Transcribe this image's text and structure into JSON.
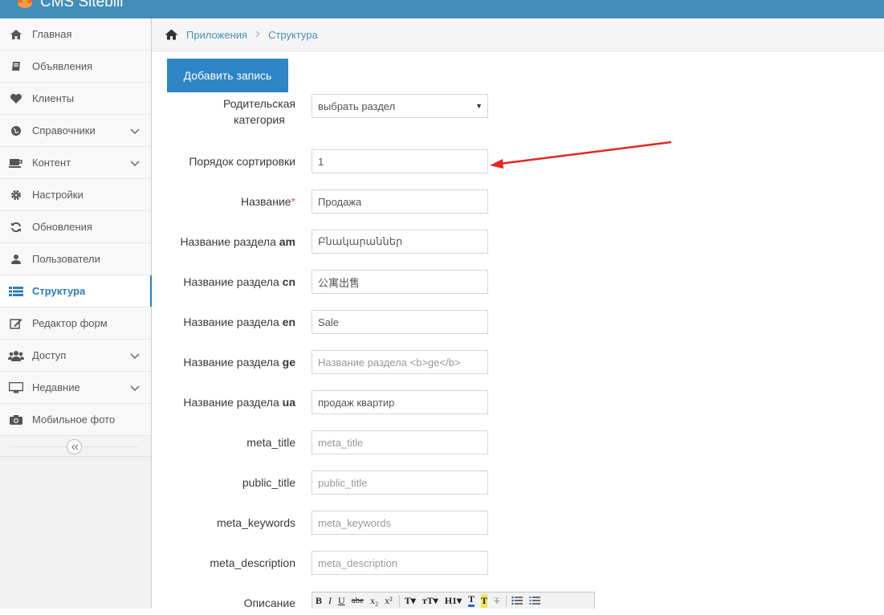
{
  "app": {
    "brand": "CMS Sitebill"
  },
  "sidebar": {
    "items": [
      {
        "label": "Главная",
        "icon": "home-icon",
        "has_submenu": false
      },
      {
        "label": "Объявления",
        "icon": "book-icon",
        "has_submenu": false
      },
      {
        "label": "Клиенты",
        "icon": "heart-icon",
        "has_submenu": false
      },
      {
        "label": "Справочники",
        "icon": "globe-icon",
        "has_submenu": true
      },
      {
        "label": "Контент",
        "icon": "coffee-icon",
        "has_submenu": true
      },
      {
        "label": "Настройки",
        "icon": "gear-icon",
        "has_submenu": false
      },
      {
        "label": "Обновления",
        "icon": "refresh-icon",
        "has_submenu": false
      },
      {
        "label": "Пользователи",
        "icon": "user-icon",
        "has_submenu": false
      },
      {
        "label": "Структура",
        "icon": "list-icon",
        "has_submenu": false,
        "active": true
      },
      {
        "label": "Редактор форм",
        "icon": "edit-icon",
        "has_submenu": false
      },
      {
        "label": "Доступ",
        "icon": "users-icon",
        "has_submenu": true
      },
      {
        "label": "Недавние",
        "icon": "desktop-icon",
        "has_submenu": true
      },
      {
        "label": "Мобильное фото",
        "icon": "camera-icon",
        "has_submenu": false
      }
    ]
  },
  "breadcrumbs": {
    "items": [
      "Приложения",
      "Структура"
    ]
  },
  "main": {
    "add_button": "Добавить запись",
    "form": {
      "parent_category": {
        "label_line1": "Родительская",
        "label_line2": "категория",
        "value": "выбрать раздел"
      },
      "sort_order": {
        "label": "Порядок сортировки",
        "value": "1"
      },
      "name": {
        "label": "Название",
        "required_mark": "*",
        "value": "Продажа"
      },
      "name_am": {
        "label": "Название раздела",
        "lang": "am",
        "value": "Բնակարաններ"
      },
      "name_cn": {
        "label": "Название раздела",
        "lang": "cn",
        "value": "公寓出售"
      },
      "name_en": {
        "label": "Название раздела",
        "lang": "en",
        "value": "Sale"
      },
      "name_ge": {
        "label": "Название раздела",
        "lang": "ge",
        "placeholder": "Название раздела <b>ge</b>"
      },
      "name_ua": {
        "label": "Название раздела",
        "lang": "ua",
        "value": "продаж квартир"
      },
      "meta_title": {
        "label": "meta_title",
        "placeholder": "meta_title"
      },
      "public_title": {
        "label": "public_title",
        "placeholder": "public_title"
      },
      "meta_keywords": {
        "label": "meta_keywords",
        "placeholder": "meta_keywords"
      },
      "meta_description": {
        "label": "meta_description",
        "placeholder": "meta_description"
      },
      "description": {
        "label": "Описание"
      }
    },
    "editor_toolbar": [
      "B",
      "I",
      "U",
      "abe",
      "x₂",
      "x²",
      "T▾",
      "тT▾",
      "H1▾",
      "T",
      "T",
      "T",
      "list",
      "numlist"
    ]
  },
  "annotation": {
    "arrow_color": "#e8261f"
  }
}
